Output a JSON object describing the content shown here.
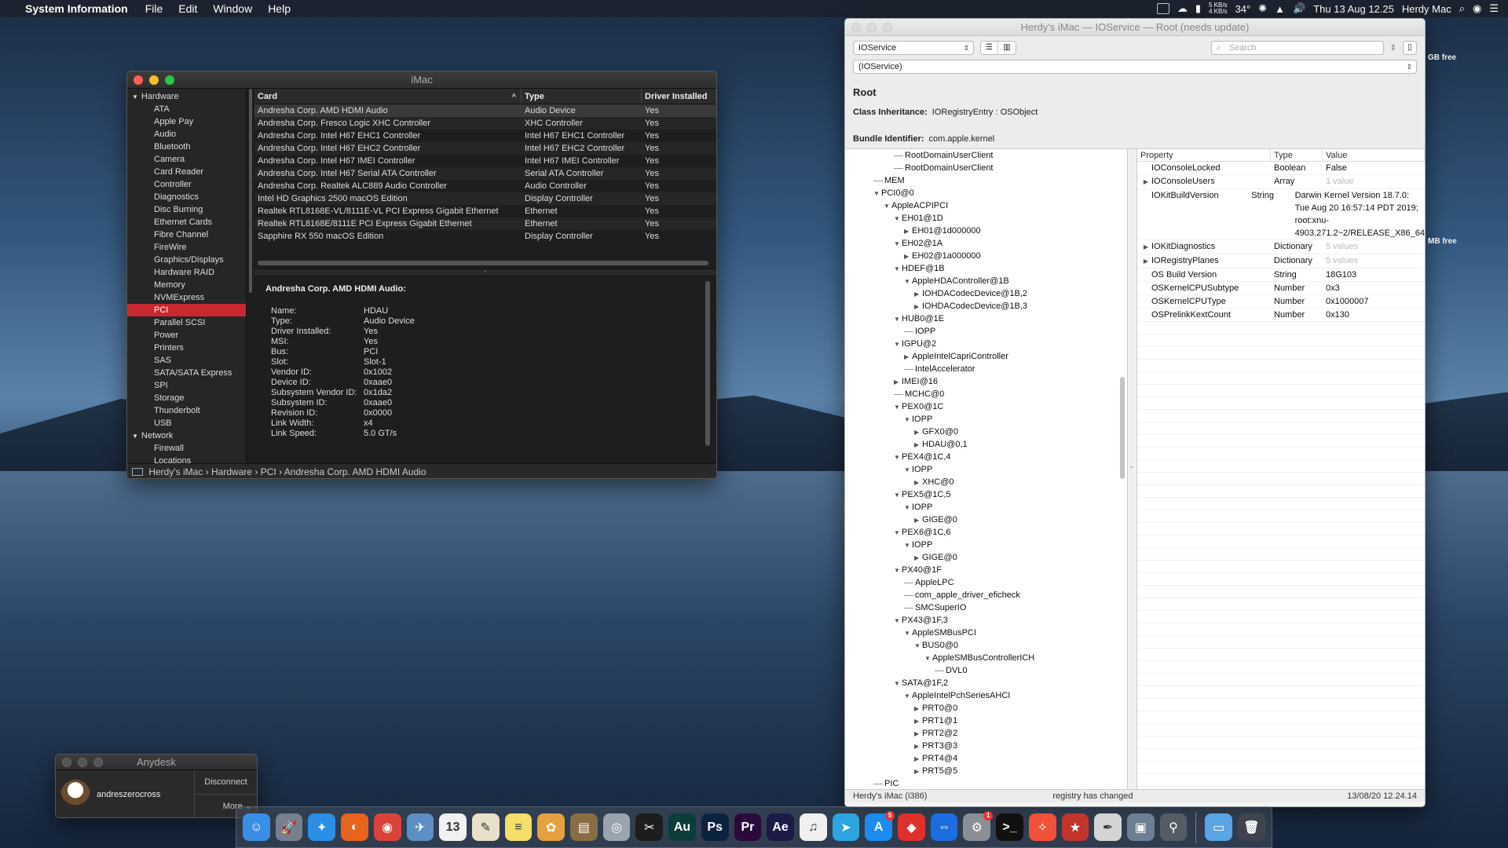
{
  "menubar": {
    "app_name": "System Information",
    "menus": [
      "File",
      "Edit",
      "Window",
      "Help"
    ],
    "net_up": "5 KB/s",
    "net_down": "4 KB/s",
    "temp": "34°",
    "clock": "Thu 13 Aug  12.25",
    "user": "Herdy Mac"
  },
  "sysinfo": {
    "title": "iMac",
    "sidebar": {
      "hardware_label": "Hardware",
      "hardware_items": [
        "ATA",
        "Apple Pay",
        "Audio",
        "Bluetooth",
        "Camera",
        "Card Reader",
        "Controller",
        "Diagnostics",
        "Disc Burning",
        "Ethernet Cards",
        "Fibre Channel",
        "FireWire",
        "Graphics/Displays",
        "Hardware RAID",
        "Memory",
        "NVMExpress",
        "PCI",
        "Parallel SCSI",
        "Power",
        "Printers",
        "SAS",
        "SATA/SATA Express",
        "SPI",
        "Storage",
        "Thunderbolt",
        "USB"
      ],
      "selected": "PCI",
      "network_label": "Network",
      "network_items": [
        "Firewall",
        "Locations"
      ]
    },
    "columns": [
      "Card",
      "Type",
      "Driver Installed"
    ],
    "rows": [
      [
        "Andresha Corp. AMD HDMI Audio",
        "Audio Device",
        "Yes"
      ],
      [
        "Andresha Corp. Fresco Logic XHC Controller",
        "XHC Controller",
        "Yes"
      ],
      [
        "Andresha Corp. Intel H67 EHC1 Controller",
        "Intel H67 EHC1 Controller",
        "Yes"
      ],
      [
        "Andresha Corp. Intel H67 EHC2 Controller",
        "Intel H67 EHC2 Controller",
        "Yes"
      ],
      [
        "Andresha Corp. Intel H67 IMEI Controller",
        "Intel H67 IMEI Controller",
        "Yes"
      ],
      [
        "Andresha Corp. Intel H67 Serial ATA Controller",
        "Serial ATA Controller",
        "Yes"
      ],
      [
        "Andresha Corp. Realtek ALC889 Audio Controller",
        "Audio Controller",
        "Yes"
      ],
      [
        "Intel HD Graphics 2500 macOS Edition",
        "Display Controller",
        "Yes"
      ],
      [
        "Realtek RTL8168E-VL/8111E-VL PCI Express Gigabit Ethernet",
        "Ethernet",
        "Yes"
      ],
      [
        "Realtek RTL8168E/8111E PCI Express Gigabit Ethernet",
        "Ethernet",
        "Yes"
      ],
      [
        "Sapphire RX 550 macOS Edition",
        "Display Controller",
        "Yes"
      ]
    ],
    "detail_title": "Andresha Corp. AMD HDMI Audio:",
    "details": [
      [
        "Name:",
        "HDAU"
      ],
      [
        "Type:",
        "Audio Device"
      ],
      [
        "Driver Installed:",
        "Yes"
      ],
      [
        "MSI:",
        "Yes"
      ],
      [
        "Bus:",
        "PCI"
      ],
      [
        "Slot:",
        "Slot-1"
      ],
      [
        "Vendor ID:",
        "0x1002"
      ],
      [
        "Device ID:",
        "0xaae0"
      ],
      [
        "Subsystem Vendor ID:",
        "0x1da2"
      ],
      [
        "Subsystem ID:",
        "0xaae0"
      ],
      [
        "Revision ID:",
        "0x0000"
      ],
      [
        "Link Width:",
        "x4"
      ],
      [
        "Link Speed:",
        "5.0 GT/s"
      ]
    ],
    "path": [
      "Herdy's iMac",
      "Hardware",
      "PCI",
      "Andresha Corp. AMD HDMI Audio"
    ]
  },
  "ioreg": {
    "title": "Herdy's iMac — IOService — Root (needs update)",
    "plane": "IOService",
    "search_placeholder": "Search",
    "plane_path": "(IOService)",
    "root_label": "Root",
    "class_inheritance_label": "Class Inheritance:",
    "class_inheritance": "IORegistryEntry : OSObject",
    "bundle_id_label": "Bundle Identifier:",
    "bundle_id": "com.apple.kernel",
    "tree": [
      {
        "depth": 4,
        "node": "leaf",
        "name": "RootDomainUserClient"
      },
      {
        "depth": 4,
        "node": "leaf",
        "name": "RootDomainUserClient"
      },
      {
        "depth": 2,
        "node": "leaf",
        "name": "MEM"
      },
      {
        "depth": 2,
        "node": "open",
        "name": "PCI0@0"
      },
      {
        "depth": 3,
        "node": "open",
        "name": "AppleACPIPCI"
      },
      {
        "depth": 4,
        "node": "open",
        "name": "EH01@1D"
      },
      {
        "depth": 5,
        "node": "closed",
        "name": "EH01@1d000000"
      },
      {
        "depth": 4,
        "node": "open",
        "name": "EH02@1A"
      },
      {
        "depth": 5,
        "node": "closed",
        "name": "EH02@1a000000"
      },
      {
        "depth": 4,
        "node": "open",
        "name": "HDEF@1B"
      },
      {
        "depth": 5,
        "node": "open",
        "name": "AppleHDAController@1B"
      },
      {
        "depth": 6,
        "node": "closed",
        "name": "IOHDACodecDevice@1B,2"
      },
      {
        "depth": 6,
        "node": "closed",
        "name": "IOHDACodecDevice@1B,3"
      },
      {
        "depth": 4,
        "node": "open",
        "name": "HUB0@1E"
      },
      {
        "depth": 5,
        "node": "leaf",
        "name": "IOPP"
      },
      {
        "depth": 4,
        "node": "open",
        "name": "IGPU@2"
      },
      {
        "depth": 5,
        "node": "closed",
        "name": "AppleIntelCapriController"
      },
      {
        "depth": 5,
        "node": "leaf",
        "name": "IntelAccelerator"
      },
      {
        "depth": 4,
        "node": "closed",
        "name": "IMEI@16"
      },
      {
        "depth": 4,
        "node": "leaf",
        "name": "MCHC@0"
      },
      {
        "depth": 4,
        "node": "open",
        "name": "PEX0@1C"
      },
      {
        "depth": 5,
        "node": "open",
        "name": "IOPP"
      },
      {
        "depth": 6,
        "node": "closed",
        "name": "GFX0@0"
      },
      {
        "depth": 6,
        "node": "closed",
        "name": "HDAU@0,1"
      },
      {
        "depth": 4,
        "node": "open",
        "name": "PEX4@1C,4"
      },
      {
        "depth": 5,
        "node": "open",
        "name": "IOPP"
      },
      {
        "depth": 6,
        "node": "closed",
        "name": "XHC@0"
      },
      {
        "depth": 4,
        "node": "open",
        "name": "PEX5@1C,5"
      },
      {
        "depth": 5,
        "node": "open",
        "name": "IOPP"
      },
      {
        "depth": 6,
        "node": "closed",
        "name": "GIGE@0"
      },
      {
        "depth": 4,
        "node": "open",
        "name": "PEX6@1C,6"
      },
      {
        "depth": 5,
        "node": "open",
        "name": "IOPP"
      },
      {
        "depth": 6,
        "node": "closed",
        "name": "GIGE@0"
      },
      {
        "depth": 4,
        "node": "open",
        "name": "PX40@1F"
      },
      {
        "depth": 5,
        "node": "leaf",
        "name": "AppleLPC"
      },
      {
        "depth": 5,
        "node": "leaf",
        "name": "com_apple_driver_eficheck"
      },
      {
        "depth": 5,
        "node": "leaf",
        "name": "SMCSuperIO"
      },
      {
        "depth": 4,
        "node": "open",
        "name": "PX43@1F,3"
      },
      {
        "depth": 5,
        "node": "open",
        "name": "AppleSMBusPCI"
      },
      {
        "depth": 6,
        "node": "open",
        "name": "BUS0@0"
      },
      {
        "depth": 7,
        "node": "open",
        "name": "AppleSMBusControllerICH"
      },
      {
        "depth": 8,
        "node": "leaf",
        "name": "DVL0"
      },
      {
        "depth": 4,
        "node": "open",
        "name": "SATA@1F,2"
      },
      {
        "depth": 5,
        "node": "open",
        "name": "AppleIntelPchSeriesAHCI"
      },
      {
        "depth": 6,
        "node": "closed",
        "name": "PRT0@0"
      },
      {
        "depth": 6,
        "node": "closed",
        "name": "PRT1@1"
      },
      {
        "depth": 6,
        "node": "closed",
        "name": "PRT2@2"
      },
      {
        "depth": 6,
        "node": "closed",
        "name": "PRT3@3"
      },
      {
        "depth": 6,
        "node": "closed",
        "name": "PRT4@4"
      },
      {
        "depth": 6,
        "node": "closed",
        "name": "PRT5@5"
      },
      {
        "depth": 2,
        "node": "leaf",
        "name": "PIC"
      }
    ],
    "prop_columns": [
      "Property",
      "Type",
      "Value"
    ],
    "props": [
      {
        "expand": false,
        "name": "IOConsoleLocked",
        "type": "Boolean",
        "value": "False",
        "muted": false
      },
      {
        "expand": true,
        "name": "IOConsoleUsers",
        "type": "Array",
        "value": "1 value",
        "muted": true
      },
      {
        "expand": false,
        "name": "IOKitBuildVersion",
        "type": "String",
        "value": "Darwin Kernel Version 18.7.0: Tue Aug 20 16:57:14 PDT 2019; root:xnu-4903.271.2~2/RELEASE_X86_64",
        "muted": false
      },
      {
        "expand": true,
        "name": "IOKitDiagnostics",
        "type": "Dictionary",
        "value": "5 values",
        "muted": true
      },
      {
        "expand": true,
        "name": "IORegistryPlanes",
        "type": "Dictionary",
        "value": "5 values",
        "muted": true
      },
      {
        "expand": false,
        "name": "OS Build Version",
        "type": "String",
        "value": "18G103",
        "muted": false
      },
      {
        "expand": false,
        "name": "OSKernelCPUSubtype",
        "type": "Number",
        "value": "0x3",
        "muted": false
      },
      {
        "expand": false,
        "name": "OSKernelCPUType",
        "type": "Number",
        "value": "0x1000007",
        "muted": false
      },
      {
        "expand": false,
        "name": "OSPrelinkKextCount",
        "type": "Number",
        "value": "0x130",
        "muted": false
      }
    ],
    "status_left": "Herdy's iMac (i386)",
    "status_mid": "registry has changed",
    "status_right": "13/08/20 12.24.14"
  },
  "desktop": {
    "free1": "GB free",
    "free2": "MB free"
  },
  "anydesk": {
    "title": "Anydesk",
    "user": "andreszerocross",
    "disconnect": "Disconnect",
    "more": "More"
  },
  "dock": [
    {
      "name": "finder-icon",
      "color": "#3a8ee6",
      "glyph": "☺"
    },
    {
      "name": "launchpad-icon",
      "color": "#777f8c",
      "glyph": "🚀"
    },
    {
      "name": "safari-icon",
      "color": "#2b8fe8",
      "glyph": "✦"
    },
    {
      "name": "firefox-icon",
      "color": "#e8631c",
      "glyph": "◐"
    },
    {
      "name": "chrome-icon",
      "color": "#d9443a",
      "glyph": "◉"
    },
    {
      "name": "preview-icon",
      "color": "#5d8fc4",
      "glyph": "✈"
    },
    {
      "name": "calendar-icon",
      "color": "#f1f1f1",
      "glyph": "13"
    },
    {
      "name": "textedit-icon",
      "color": "#e8e0c8",
      "glyph": "✎"
    },
    {
      "name": "notes-icon",
      "color": "#f3df6a",
      "glyph": "≡"
    },
    {
      "name": "photos-icon",
      "color": "#e6a040",
      "glyph": "✿"
    },
    {
      "name": "archive-utility-icon",
      "color": "#8a6d44",
      "glyph": "▤"
    },
    {
      "name": "disk-utility-icon",
      "color": "#9aa4ae",
      "glyph": "◎"
    },
    {
      "name": "final-cut-icon",
      "color": "#1d1d1d",
      "glyph": "✂"
    },
    {
      "name": "audition-icon",
      "color": "#0b3d3a",
      "glyph": "Au"
    },
    {
      "name": "photoshop-icon",
      "color": "#0c2340",
      "glyph": "Ps"
    },
    {
      "name": "premiere-icon",
      "color": "#2a0a3a",
      "glyph": "Pr"
    },
    {
      "name": "after-effects-icon",
      "color": "#1b1a48",
      "glyph": "Ae"
    },
    {
      "name": "itunes-icon",
      "color": "#f0f0f0",
      "glyph": "♫"
    },
    {
      "name": "telegram-icon",
      "color": "#2ca5e0",
      "glyph": "➤"
    },
    {
      "name": "app-store-icon",
      "color": "#1a8cf0",
      "glyph": "A"
    },
    {
      "name": "anydesk-icon",
      "color": "#e0302b",
      "glyph": "◆"
    },
    {
      "name": "teamviewer-icon",
      "color": "#1c6de0",
      "glyph": "⇔"
    },
    {
      "name": "system-preferences-icon",
      "color": "#8a8f96",
      "glyph": "⚙"
    },
    {
      "name": "terminal-icon",
      "color": "#111111",
      "glyph": ">_"
    },
    {
      "name": "swift-icon",
      "color": "#f05138",
      "glyph": "✧"
    },
    {
      "name": "cleaner-icon",
      "color": "#c2342c",
      "glyph": "★"
    },
    {
      "name": "script-editor-icon",
      "color": "#d4d4d4",
      "glyph": "✒"
    },
    {
      "name": "system-information-icon",
      "color": "#6d7f92",
      "glyph": "▣"
    },
    {
      "name": "ioreg-explorer-icon",
      "color": "#555c66",
      "glyph": "⚲"
    },
    {
      "name": "downloads-folder-icon",
      "color": "#5aa5e6",
      "glyph": "▭"
    },
    {
      "name": "trash-icon",
      "color": "#3e444d",
      "glyph": "🗑"
    }
  ],
  "dock_badges": {
    "system-preferences-icon": "1",
    "app-store-icon": "5"
  }
}
